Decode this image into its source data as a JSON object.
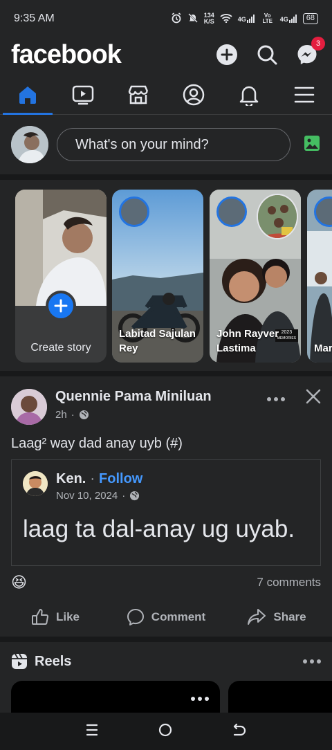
{
  "status_bar": {
    "time": "9:35 AM",
    "net_speed_value": "134",
    "net_speed_unit": "K/S",
    "signal_1": "4G",
    "volte": "Vo LTE",
    "signal_2": "4G",
    "battery": "68"
  },
  "header": {
    "logo": "facebook",
    "messenger_badge": "3"
  },
  "tabs": [
    {
      "name": "home",
      "active": true
    },
    {
      "name": "video",
      "active": false
    },
    {
      "name": "marketplace",
      "active": false
    },
    {
      "name": "profile",
      "active": false
    },
    {
      "name": "notifications",
      "active": false
    },
    {
      "name": "menu",
      "active": false
    }
  ],
  "composer": {
    "placeholder": "What's on your mind?"
  },
  "stories": {
    "create_label": "Create story",
    "items": [
      {
        "name": "Labitad Sajulan Rey"
      },
      {
        "name": "John Rayver Lastima",
        "tag": "2023",
        "tag_sub": "MEMORIES"
      },
      {
        "name": "Mar Ratu"
      }
    ]
  },
  "post": {
    "author": "Quennie Pama Miniluan",
    "time": "2h",
    "text": "Laag² way dad anay uyb (#)",
    "shared": {
      "author": "Ken.",
      "follow_label": "Follow",
      "date": "Nov 10, 2024",
      "text": "laag ta dal-anay ug uyab."
    },
    "reaction_emoji": "😆",
    "comments": "7 comments",
    "actions": {
      "like": "Like",
      "comment": "Comment",
      "share": "Share"
    }
  },
  "reels": {
    "title": "Reels"
  },
  "colors": {
    "background": "#242526",
    "accent": "#2374e1",
    "badge": "#e41e3f",
    "text": "#e4e6eb",
    "secondary_text": "#b0b3b8",
    "photo_icon": "#45bd62"
  }
}
